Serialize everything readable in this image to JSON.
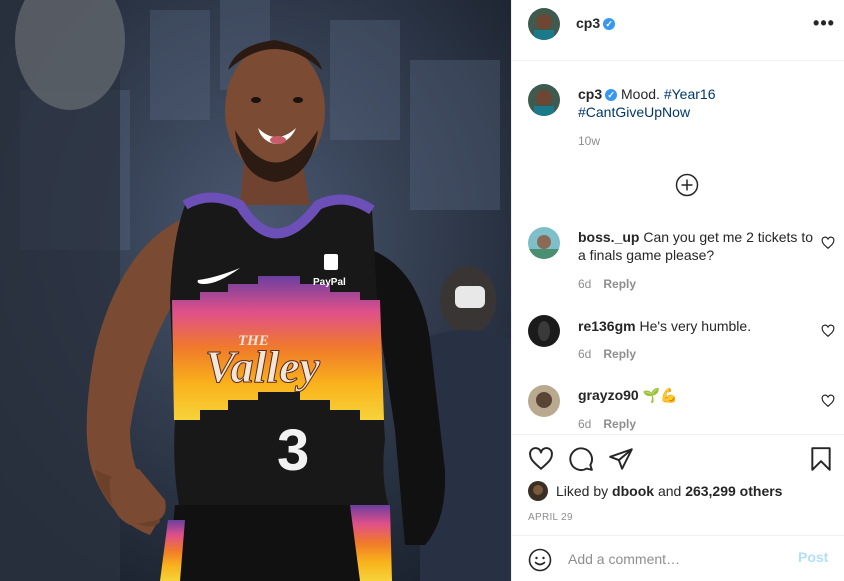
{
  "post": {
    "author": "cp3",
    "verified": true
  },
  "caption": {
    "username": "cp3",
    "text": "Mood.",
    "hashtag_1": "#Year16",
    "hashtag_2": "#CantGiveUpNow",
    "age": "10w"
  },
  "jersey": {
    "sponsor": "PayPal",
    "the": "THE",
    "valley": "Valley",
    "number": "3"
  },
  "comments": [
    {
      "username": "boss._up",
      "text": "Can you get me 2 tickets to a finals game please?",
      "age": "6d",
      "reply_label": "Reply"
    },
    {
      "username": "re136gm",
      "text": "He's very humble.",
      "age": "6d",
      "reply_label": "Reply"
    },
    {
      "username": "grayzo90",
      "text": "🌱💪",
      "age": "6d",
      "reply_label": "Reply"
    }
  ],
  "likes": {
    "prefix": "Liked by",
    "liker": "dbook",
    "middle": "and",
    "count": "263,299 others"
  },
  "date": "APRIL 29",
  "add_comment": {
    "placeholder": "Add a comment…",
    "post_label": "Post"
  },
  "colors": {
    "verified_blue": "#3897f0",
    "hashtag_blue": "#00376b",
    "post_button_disabled": "#b2dffc",
    "secondary_text": "#8e8e8e"
  },
  "icons": [
    "more-options-icon",
    "load-more-comments-icon",
    "heart-icon",
    "comment-icon",
    "share-icon",
    "save-icon",
    "emoji-icon"
  ]
}
